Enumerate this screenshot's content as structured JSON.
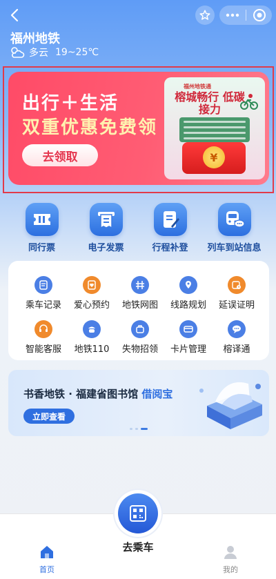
{
  "header": {
    "city": "福州地铁",
    "weather_condition": "多云",
    "temperature": "19~25℃"
  },
  "banner": {
    "line1": "出行＋生活",
    "line2": "双重优惠免费领",
    "claim_button": "去领取",
    "promo_tag": "福州地铁通",
    "promo_title": "榕城畅行 低碳接力",
    "coin_symbol": "¥"
  },
  "quick_nav": [
    {
      "label": "同行票",
      "icon": "ticket-icon"
    },
    {
      "label": "电子发票",
      "icon": "invoice-icon"
    },
    {
      "label": "行程补登",
      "icon": "trip-edit-icon"
    },
    {
      "label": "列车到站信息",
      "icon": "train-arrival-icon"
    }
  ],
  "services": [
    {
      "label": "乘车记录",
      "icon": "ride-record-icon",
      "color": "#4b7fe5"
    },
    {
      "label": "爱心预约",
      "icon": "care-booking-icon",
      "color": "#f08a2c"
    },
    {
      "label": "地铁网图",
      "icon": "metro-map-icon",
      "color": "#4b7fe5"
    },
    {
      "label": "线路规划",
      "icon": "route-plan-icon",
      "color": "#4b7fe5"
    },
    {
      "label": "延误证明",
      "icon": "delay-proof-icon",
      "color": "#f08a2c"
    },
    {
      "label": "智能客服",
      "icon": "smart-service-icon",
      "color": "#f08a2c"
    },
    {
      "label": "地铁110",
      "icon": "police-icon",
      "color": "#4b7fe5"
    },
    {
      "label": "失物招领",
      "icon": "lost-found-icon",
      "color": "#4b7fe5"
    },
    {
      "label": "卡片管理",
      "icon": "card-manage-icon",
      "color": "#4b7fe5"
    },
    {
      "label": "榕译通",
      "icon": "translate-icon",
      "color": "#4b7fe5"
    }
  ],
  "library": {
    "title_prefix": "书香地铁 · 福建省图书馆 ",
    "title_accent": "借阅宝",
    "button": "立即查看"
  },
  "tabbar": {
    "home": "首页",
    "ride": "去乘车",
    "mine": "我的"
  },
  "colors": {
    "brand_blue": "#2f6fe0",
    "banner_red": "#ff4b67",
    "active_tab": "#2f6fe0"
  }
}
